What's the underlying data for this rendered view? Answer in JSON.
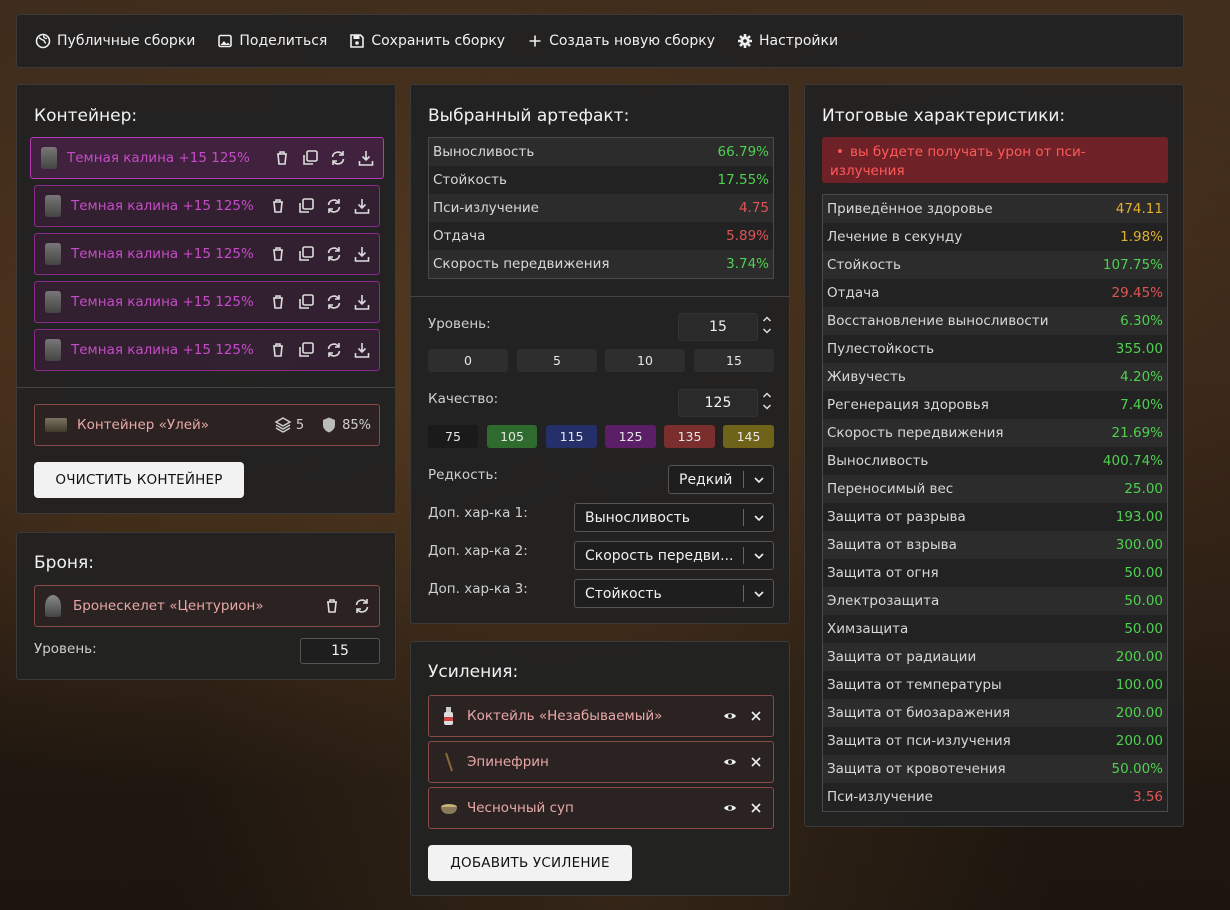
{
  "topbar": {
    "public_builds": "Публичные сборки",
    "share": "Поделиться",
    "save_build": "Сохранить сборку",
    "new_build": "Создать новую сборку",
    "settings": "Настройки"
  },
  "container": {
    "title": "Контейнер:",
    "artifacts": [
      {
        "name": "Темная калина +15 125%"
      },
      {
        "name": "Темная калина +15 125%"
      },
      {
        "name": "Темная калина +15 125%"
      },
      {
        "name": "Темная калина +15 125%"
      },
      {
        "name": "Темная калина +15 125%"
      }
    ],
    "hive": {
      "name": "Контейнер «Улей»",
      "capacity": "5",
      "protection": "85%"
    },
    "clear_button": "ОЧИСТИТЬ КОНТЕЙНЕР"
  },
  "armor": {
    "title": "Броня:",
    "name": "Бронескелет «Центурион»",
    "level_label": "Уровень:",
    "level_value": "15"
  },
  "artifact": {
    "title": "Выбранный артефакт:",
    "stats": [
      {
        "label": "Выносливость",
        "value": "66.79%",
        "color": "green"
      },
      {
        "label": "Стойкость",
        "value": "17.55%",
        "color": "green"
      },
      {
        "label": "Пси-излучение",
        "value": "4.75",
        "color": "red"
      },
      {
        "label": "Отдача",
        "value": "5.89%",
        "color": "red"
      },
      {
        "label": "Скорость передвижения",
        "value": "3.74%",
        "color": "green"
      }
    ],
    "level_label": "Уровень:",
    "level_value": "15",
    "level_presets": [
      "0",
      "5",
      "10",
      "15"
    ],
    "quality_label": "Качество:",
    "quality_value": "125",
    "quality_presets": [
      {
        "label": "75",
        "bg": "#1a1a1a"
      },
      {
        "label": "105",
        "bg": "#2f6b2f"
      },
      {
        "label": "115",
        "bg": "#25306a"
      },
      {
        "label": "125",
        "bg": "#5a1f66"
      },
      {
        "label": "135",
        "bg": "#7a2e2e"
      },
      {
        "label": "145",
        "bg": "#6e6318"
      }
    ],
    "rarity_label": "Редкость:",
    "rarity_value": "Редкий",
    "extra1_label": "Доп. хар-ка 1:",
    "extra1_value": "Выносливость",
    "extra2_label": "Доп. хар-ка 2:",
    "extra2_value": "Скорость передви...",
    "extra3_label": "Доп. хар-ка 3:",
    "extra3_value": "Стойкость"
  },
  "boosts": {
    "title": "Усиления:",
    "items": [
      {
        "name": "Коктейль «Незабываемый»"
      },
      {
        "name": "Эпинефрин"
      },
      {
        "name": "Чесночный суп"
      }
    ],
    "add_button": "ДОБАВИТЬ УСИЛЕНИЕ"
  },
  "totals": {
    "title": "Итоговые характеристики:",
    "warning": "вы будете получать урон от пси-излучения",
    "stats": [
      {
        "label": "Приведённое здоровье",
        "value": "474.11",
        "color": "yellow"
      },
      {
        "label": "Лечение в секунду",
        "value": "1.98%",
        "color": "yellow"
      },
      {
        "label": "Стойкость",
        "value": "107.75%",
        "color": "green"
      },
      {
        "label": "Отдача",
        "value": "29.45%",
        "color": "red"
      },
      {
        "label": "Восстановление выносливости",
        "value": "6.30%",
        "color": "green"
      },
      {
        "label": "Пулестойкость",
        "value": "355.00",
        "color": "green"
      },
      {
        "label": "Живучесть",
        "value": "4.20%",
        "color": "green"
      },
      {
        "label": "Регенерация здоровья",
        "value": "7.40%",
        "color": "green"
      },
      {
        "label": "Скорость передвижения",
        "value": "21.69%",
        "color": "green"
      },
      {
        "label": "Выносливость",
        "value": "400.74%",
        "color": "green"
      },
      {
        "label": "Переносимый вес",
        "value": "25.00",
        "color": "green"
      },
      {
        "label": "Защита от разрыва",
        "value": "193.00",
        "color": "green"
      },
      {
        "label": "Защита от взрыва",
        "value": "300.00",
        "color": "green"
      },
      {
        "label": "Защита от огня",
        "value": "50.00",
        "color": "green"
      },
      {
        "label": "Электрозащита",
        "value": "50.00",
        "color": "green"
      },
      {
        "label": "Химзащита",
        "value": "50.00",
        "color": "green"
      },
      {
        "label": "Защита от радиации",
        "value": "200.00",
        "color": "green"
      },
      {
        "label": "Защита от температуры",
        "value": "100.00",
        "color": "green"
      },
      {
        "label": "Защита от биозаражения",
        "value": "200.00",
        "color": "green"
      },
      {
        "label": "Защита от пси-излучения",
        "value": "200.00",
        "color": "green"
      },
      {
        "label": "Защита от кровотечения",
        "value": "50.00%",
        "color": "green"
      },
      {
        "label": "Пси-излучение",
        "value": "3.56",
        "color": "red"
      }
    ]
  }
}
